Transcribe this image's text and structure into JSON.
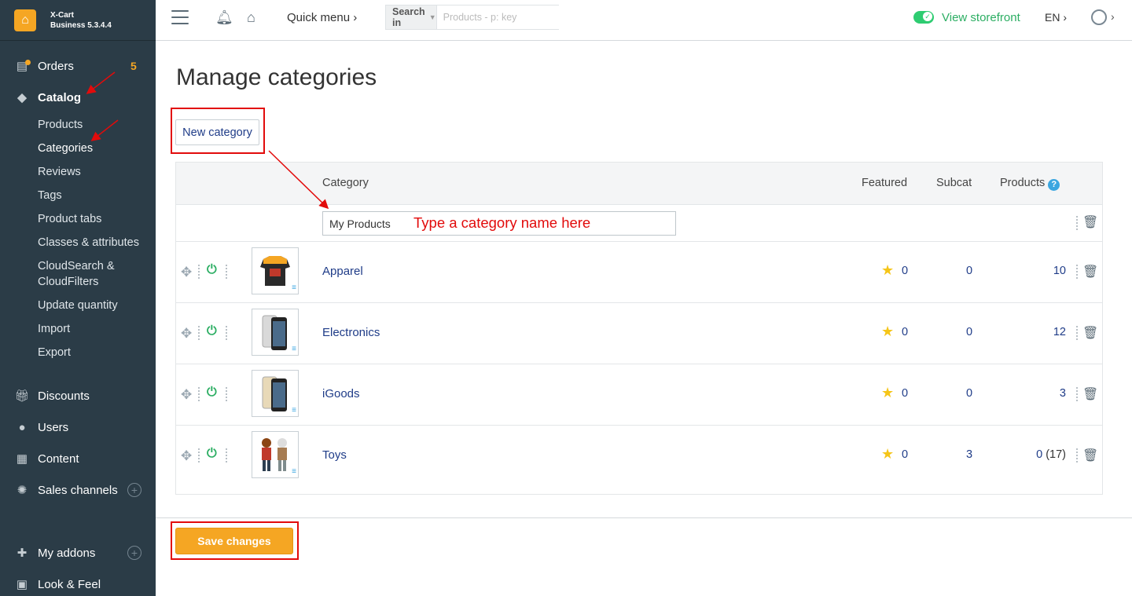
{
  "brand": {
    "name": "X-Cart",
    "version": "Business 5.3.4.4"
  },
  "sidebar": {
    "orders": {
      "label": "Orders",
      "badge": "5"
    },
    "catalog": {
      "label": "Catalog"
    },
    "catalog_sub": [
      "Products",
      "Categories",
      "Reviews",
      "Tags",
      "Product tabs",
      "Classes & attributes",
      "CloudSearch & CloudFilters",
      "Update quantity",
      "Import",
      "Export"
    ],
    "discounts": "Discounts",
    "users": "Users",
    "content": "Content",
    "sales_channels": "Sales channels",
    "my_addons": "My addons",
    "look_feel": "Look & Feel"
  },
  "header": {
    "quick_menu": "Quick menu",
    "search_in": "Search in",
    "search_placeholder": "Products - p: key",
    "view_storefront": "View storefront",
    "lang": "EN"
  },
  "page": {
    "title": "Manage categories",
    "new_category": "New category",
    "save_changes": "Save changes"
  },
  "table": {
    "headers": {
      "category": "Category",
      "featured": "Featured",
      "subcat": "Subcat",
      "products": "Products"
    },
    "new_row": {
      "value": "My Products",
      "annotation": "Type a category name here"
    },
    "rows": [
      {
        "name": "Apparel",
        "featured": "0",
        "subcat": "0",
        "products": "10",
        "products_extra": ""
      },
      {
        "name": "Electronics",
        "featured": "0",
        "subcat": "0",
        "products": "12",
        "products_extra": ""
      },
      {
        "name": "iGoods",
        "featured": "0",
        "subcat": "0",
        "products": "3",
        "products_extra": ""
      },
      {
        "name": "Toys",
        "featured": "0",
        "subcat": "3",
        "products": "0",
        "products_extra": " (17)"
      }
    ]
  },
  "colors": {
    "sidebar": "#2b3c47",
    "accent": "#f5a623",
    "link": "#1f3c88",
    "green": "#2cae63",
    "annotation": "#e20b0b"
  }
}
